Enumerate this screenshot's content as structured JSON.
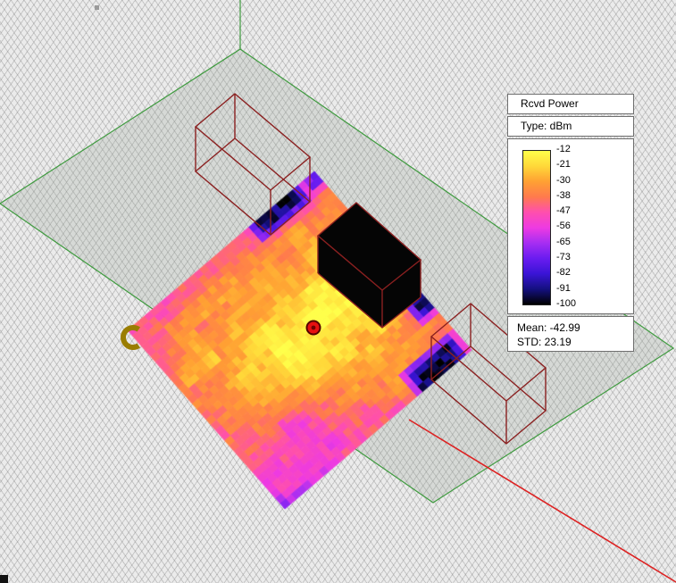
{
  "legend": {
    "title": "Rcvd Power",
    "type_label": "Type: dBm",
    "scale_labels": [
      "-12",
      "-21",
      "-30",
      "-38",
      "-47",
      "-56",
      "-65",
      "-73",
      "-82",
      "-91",
      "-100"
    ],
    "mean": "Mean: -42.99",
    "std": "STD: 23.19"
  },
  "chart_data": {
    "type": "heatmap",
    "title": "Rcvd Power",
    "units": "dBm",
    "legend_position": "top-right",
    "scale_ticks": [
      -12,
      -21,
      -30,
      -38,
      -47,
      -56,
      -65,
      -73,
      -82,
      -91,
      -100
    ],
    "scale_range": [
      -100,
      -12
    ],
    "mean": -42.99,
    "std": 23.19,
    "palette": [
      {
        "dbm": -12,
        "color": "#ffff4a"
      },
      {
        "dbm": -21,
        "color": "#ffd839"
      },
      {
        "dbm": -30,
        "color": "#ffa033"
      },
      {
        "dbm": -38,
        "color": "#ff7a4d"
      },
      {
        "dbm": -47,
        "color": "#ff4fae"
      },
      {
        "dbm": -56,
        "color": "#ee3ae2"
      },
      {
        "dbm": -65,
        "color": "#a62ef2"
      },
      {
        "dbm": -73,
        "color": "#6a1cf0"
      },
      {
        "dbm": -82,
        "color": "#3a14d6"
      },
      {
        "dbm": -91,
        "color": "#141080"
      },
      {
        "dbm": -100,
        "color": "#000000"
      }
    ],
    "colors": {
      "terrain_outline": "#3f9b3f",
      "building_wireframe": "#8b2020",
      "transmitter": "#e81010",
      "route_line": "#dd2222",
      "receiver_arc": "#9a7d00"
    }
  }
}
